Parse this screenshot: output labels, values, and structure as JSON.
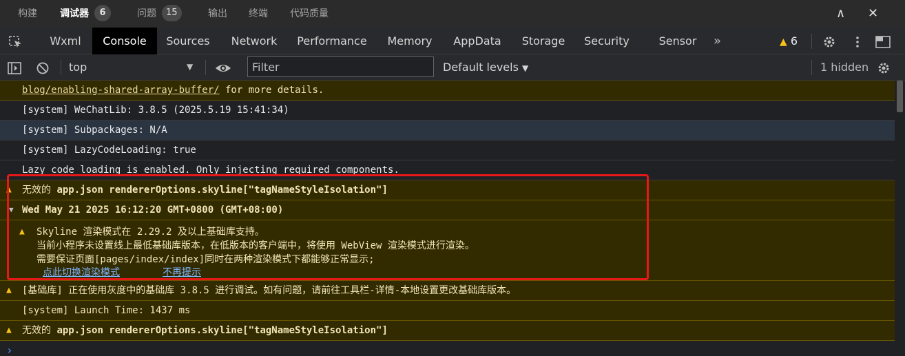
{
  "panel_tabs": [
    {
      "label": "构建"
    },
    {
      "label": "调试器",
      "badge": "6",
      "active": true
    },
    {
      "label": "问题",
      "badge": "15"
    },
    {
      "label": "输出"
    },
    {
      "label": "终端"
    },
    {
      "label": "代码质量"
    }
  ],
  "panel_controls": {
    "collapse_glyph": "∧",
    "close_glyph": "✕"
  },
  "devtools_tabs": [
    "Wxml",
    "Console",
    "Sources",
    "Network",
    "Performance",
    "Memory",
    "AppData",
    "Storage",
    "Security",
    "Sensor"
  ],
  "devtools_active_tab": "Console",
  "devtools_more_glyph": "»",
  "warnings_count": "6",
  "toolbar": {
    "context": "top",
    "filter_placeholder": "Filter",
    "levels": "Default levels",
    "hidden": "1 hidden"
  },
  "log": {
    "row_shared_buffer": {
      "link": "blog/enabling-shared-array-buffer/",
      "text": " for more details."
    },
    "row_wechatlib": "[system] WeChatLib: 3.8.5 (2025.5.19 15:41:34)",
    "row_subpackages": "[system] Subpackages: N/A",
    "row_lazy_loading": "[system] LazyCodeLoading: true",
    "row_lazy_enabled": "Lazy code loading is enabled. Only injecting required components.",
    "row_invalid_1": {
      "prefix": "无效的 ",
      "code": "app.json rendererOptions.skyline[\"tagNameStyleIsolation\"]"
    },
    "group_header": "Wed May 21 2025 16:12:20 GMT+0800 (GMT+08:00)",
    "group_body": {
      "line1": "Skyline 渲染模式在 2.29.2 及以上基础库支持。",
      "line2": "当前小程序未设置线上最低基础库版本，在低版本的客户端中，将使用 WebView 渲染模式进行渲染。",
      "line3": "需要保证页面[pages/index/index]同时在两种渲染模式下都能够正常显示;",
      "link_switch": "点此切换渲染模式",
      "link_never": "不再提示"
    },
    "row_baseline": "[基础库] 正在使用灰度中的基础库 3.8.5 进行调试。如有问题，请前往工具栏-详情-本地设置更改基础库版本。",
    "row_launch": "[system] Launch Time: 1437 ms",
    "row_invalid_2": {
      "prefix": "无效的 ",
      "code": "app.json rendererOptions.skyline[\"tagNameStyleIsolation\"]"
    },
    "prompt_glyph": "›"
  },
  "colors": {
    "warning": "#f9c21a",
    "highlight": "#e81818",
    "link": "#7eb6ff"
  }
}
